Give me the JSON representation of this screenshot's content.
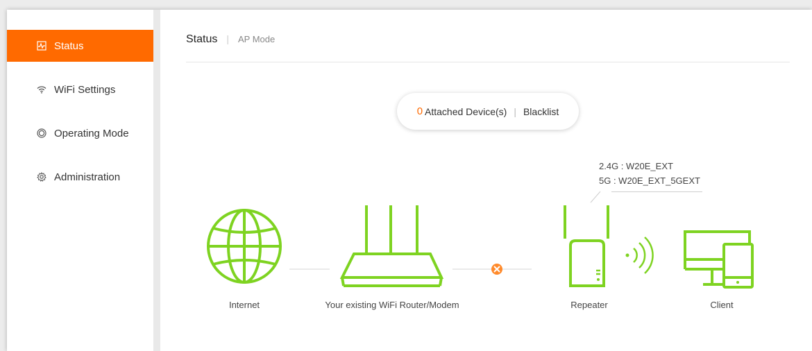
{
  "sidebar": {
    "items": [
      {
        "label": "Status",
        "icon": "status-icon",
        "active": true
      },
      {
        "label": "WiFi Settings",
        "icon": "wifi-icon",
        "active": false
      },
      {
        "label": "Operating Mode",
        "icon": "operating-mode-icon",
        "active": false
      },
      {
        "label": "Administration",
        "icon": "gear-icon",
        "active": false
      }
    ]
  },
  "header": {
    "title": "Status",
    "separator": "|",
    "mode": "AP Mode"
  },
  "devices": {
    "count": "0",
    "label": "Attached Device(s)",
    "separator": "|",
    "blacklist": "Blacklist"
  },
  "ssid": {
    "band_24": "2.4G :  W20E_EXT",
    "band_5": "5G :  W20E_EXT_5GEXT"
  },
  "topology": {
    "internet": "Internet",
    "router": "Your existing WiFi Router/Modem",
    "repeater": "Repeater",
    "client": "Client",
    "router_link_status": "disconnected"
  },
  "colors": {
    "accent": "#ff6a00",
    "device_green": "#7ed321"
  }
}
